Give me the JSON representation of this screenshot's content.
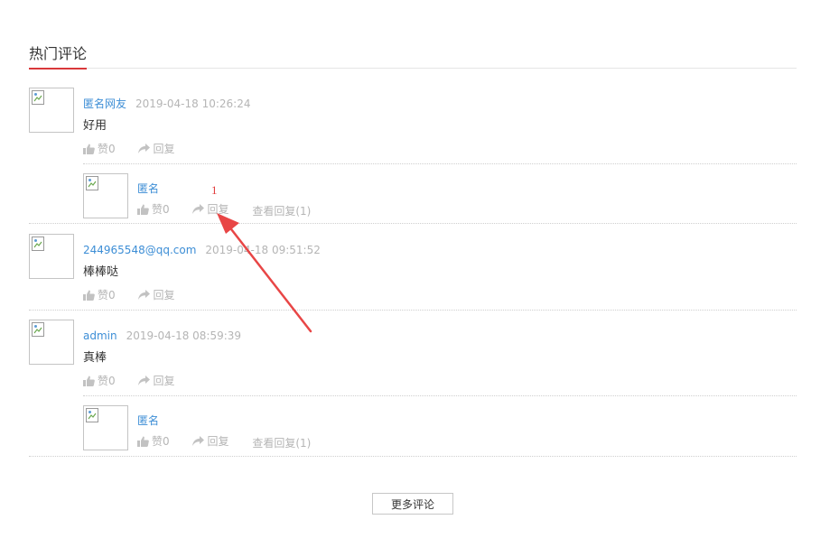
{
  "section": {
    "title": "热门评论"
  },
  "comments": [
    {
      "author": "匿名网友",
      "time": "2019-04-18 10:26:24",
      "content": "好用",
      "like": "赞0",
      "reply": "回复",
      "replies": [
        {
          "author": "匿名",
          "like": "赞0",
          "reply": "回复",
          "view_replies": "查看回复(1)"
        }
      ]
    },
    {
      "author": "244965548@qq.com",
      "time": "2019-04-18 09:51:52",
      "content": "棒棒哒",
      "like": "赞0",
      "reply": "回复",
      "replies": []
    },
    {
      "author": "admin",
      "time": "2019-04-18 08:59:39",
      "content": "真棒",
      "like": "赞0",
      "reply": "回复",
      "replies": [
        {
          "author": "匿名",
          "like": "赞0",
          "reply": "回复",
          "view_replies": "查看回复(1)"
        }
      ]
    }
  ],
  "more_button": "更多评论",
  "annotation": {
    "number": "1",
    "color": "#e13b3b"
  },
  "colors": {
    "accent": "#d9383a",
    "link": "#3d8ed6",
    "muted": "#b5b5b5"
  }
}
